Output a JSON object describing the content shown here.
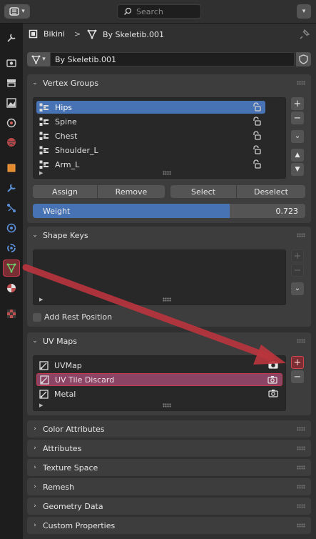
{
  "topbar": {
    "search_placeholder": "Search"
  },
  "header": {
    "object_name": "Bikini",
    "separator": ">",
    "mesh_name": "By Skeletib.001"
  },
  "datablock": {
    "name": "By Skeletib.001"
  },
  "vertex_groups": {
    "title": "Vertex Groups",
    "items": [
      {
        "label": "Hips"
      },
      {
        "label": "Spine"
      },
      {
        "label": "Chest"
      },
      {
        "label": "Shoulder_L"
      },
      {
        "label": "Arm_L"
      }
    ],
    "selected_index": 0,
    "assign_label": "Assign",
    "remove_label": "Remove",
    "select_label": "Select",
    "deselect_label": "Deselect",
    "weight_label": "Weight",
    "weight_value": "0.723",
    "weight_fraction": 0.723
  },
  "shape_keys": {
    "title": "Shape Keys",
    "add_rest_position_label": "Add Rest Position"
  },
  "uv_maps": {
    "title": "UV Maps",
    "items": [
      {
        "label": "UVMap"
      },
      {
        "label": "UV Tile Discard"
      },
      {
        "label": "Metal"
      }
    ],
    "highlighted_index": 1
  },
  "collapsed_panels": [
    {
      "label": "Color Attributes"
    },
    {
      "label": "Attributes"
    },
    {
      "label": "Texture Space"
    },
    {
      "label": "Remesh"
    },
    {
      "label": "Geometry Data"
    },
    {
      "label": "Custom Properties"
    }
  ],
  "side_buttons": {
    "add": "+",
    "remove": "−"
  },
  "colors": {
    "selection_blue": "#4772b3",
    "annotation_red": "#c0303a",
    "highlight_row": "#8b4463"
  },
  "icons": {
    "editor_type": "properties-editor-icon",
    "search": "search-icon",
    "pin": "pin-icon",
    "active_tab": "mesh-data-tab-icon",
    "annotation": "red-arrow"
  }
}
